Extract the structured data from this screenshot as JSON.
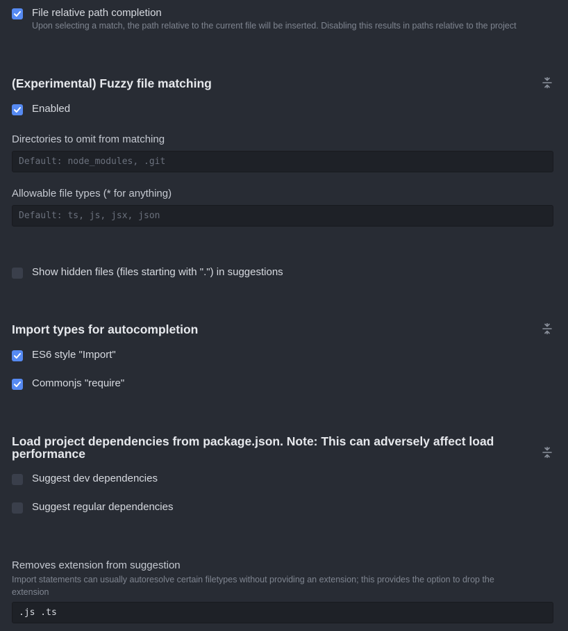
{
  "file_relative": {
    "label": "File relative path completion",
    "description": "Upon selecting a match, the path relative to the current file will be inserted. Disabling this results in paths relative to the project",
    "checked": true
  },
  "fuzzy": {
    "title": "(Experimental) Fuzzy file matching",
    "collapse_icon": "collapse-icon",
    "enabled_label": "Enabled",
    "enabled_checked": true,
    "omit_label": "Directories to omit from matching",
    "omit_placeholder": "Default: node_modules, .git",
    "omit_value": "",
    "filetypes_label": "Allowable file types (* for anything)",
    "filetypes_placeholder": "Default: ts, js, jsx, json",
    "filetypes_value": ""
  },
  "hidden_files": {
    "label": "Show hidden files (files starting with \".\") in suggestions",
    "checked": false
  },
  "import_types": {
    "title": "Import types for autocompletion",
    "collapse_icon": "collapse-icon",
    "es6_label": "ES6 style \"Import\"",
    "es6_checked": true,
    "commonjs_label": "Commonjs \"require\"",
    "commonjs_checked": true
  },
  "dependencies": {
    "title": "Load project dependencies from package.json. Note: This can adversely affect load performance",
    "collapse_icon": "collapse-icon",
    "dev_label": "Suggest dev dependencies",
    "dev_checked": false,
    "regular_label": "Suggest regular dependencies",
    "regular_checked": false
  },
  "remove_extension": {
    "label": "Removes extension from suggestion",
    "description": "Import statements can usually autoresolve certain filetypes without providing an extension; this provides the option to drop the extension",
    "value": ".js .ts"
  },
  "colors": {
    "background": "#282c34",
    "accent": "#568af2",
    "input_background": "#1e2127"
  }
}
